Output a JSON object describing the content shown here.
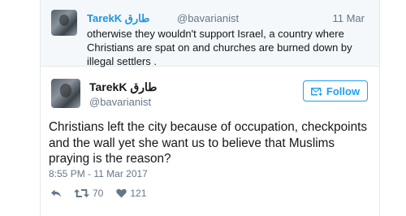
{
  "reply_tweet": {
    "name": "TarekK طارق",
    "handle": "@bavarianist",
    "date": "11 Mar",
    "text": "otherwise they wouldn't support Israel, a country where Christians are spat on and churches are burned down by illegal settlers ."
  },
  "main_tweet": {
    "name": "TarekK طارق",
    "handle": "@bavarianist",
    "follow_label": "Follow",
    "text": "Christians left the city because of occupation, checkpoints and the wall yet she want us to believe that Muslims praying is the reason?",
    "timestamp": "8:55 PM - 11 Mar 2017",
    "retweets": "70",
    "likes": "121"
  },
  "icons": {
    "follow": "add-user-icon",
    "reply": "reply-icon",
    "retweet": "retweet-icon",
    "like": "heart-icon"
  },
  "colors": {
    "accent": "#1da1f2",
    "name_link": "#1b95e0",
    "muted": "#657786",
    "reply_bg": "#f5f8fa"
  }
}
